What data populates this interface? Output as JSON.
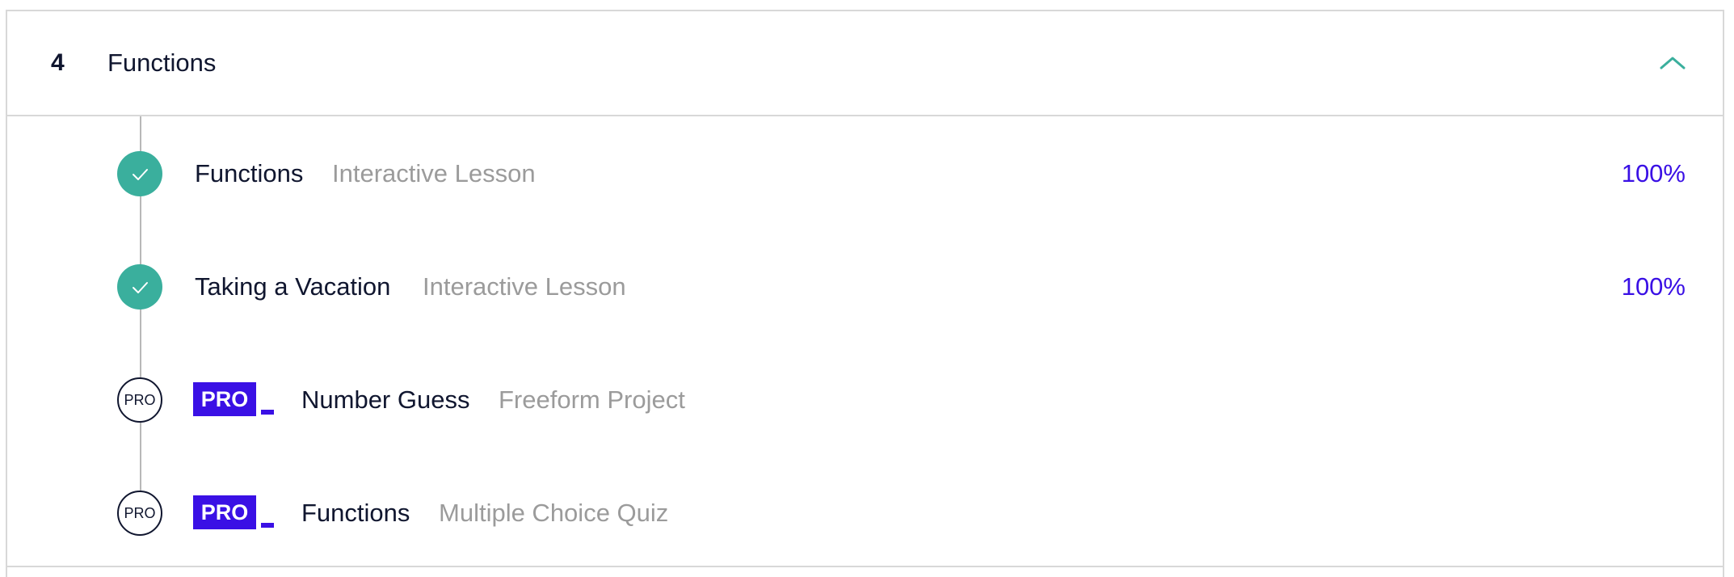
{
  "module": {
    "number": "4",
    "title": "Functions",
    "expanded_icon": "chevron-up-icon",
    "accent_color": "#3aaf9d"
  },
  "lessons": [
    {
      "title": "Functions",
      "type": "Interactive Lesson",
      "status": "complete",
      "status_icon": "check-icon",
      "progress": "100%"
    },
    {
      "title": "Taking a Vacation",
      "type": "Interactive Lesson",
      "status": "complete",
      "status_icon": "check-icon",
      "progress": "100%"
    },
    {
      "title": "Number Guess",
      "type": "Freeform Project",
      "status": "pro",
      "status_label": "PRO",
      "badge_label": "PRO"
    },
    {
      "title": "Functions",
      "type": "Multiple Choice Quiz",
      "status": "pro",
      "status_label": "PRO",
      "badge_label": "PRO"
    }
  ],
  "colors": {
    "complete": "#3aaf9d",
    "pro_badge": "#3a10e5",
    "progress_text": "#3a10e5",
    "muted_text": "#9b9b9b",
    "primary_text": "#10162f"
  }
}
